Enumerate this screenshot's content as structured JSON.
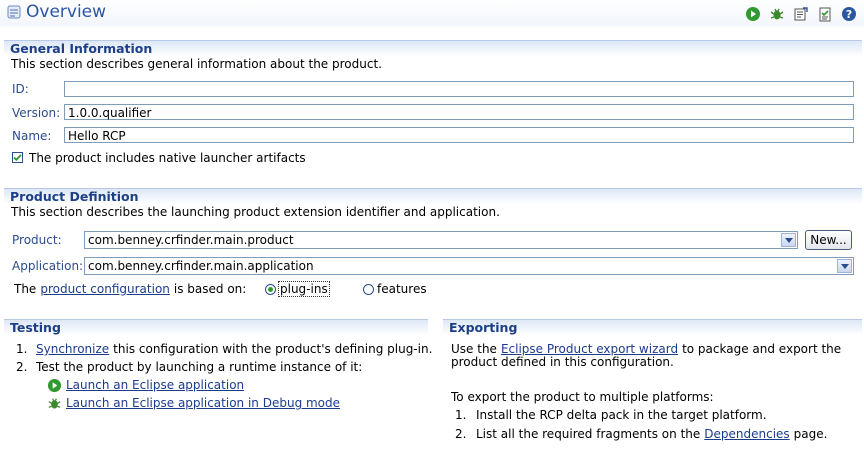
{
  "header": {
    "title": "Overview"
  },
  "toolbar": {
    "icons": [
      "run-icon",
      "debug-icon",
      "export-icon",
      "sync-icon",
      "help-icon"
    ]
  },
  "general": {
    "heading": "General Information",
    "description": "This section describes general information about the product.",
    "id_label": "ID:",
    "id_value": "",
    "version_label": "Version:",
    "version_value": "1.0.0.qualifier",
    "name_label": "Name:",
    "name_value": "Hello RCP",
    "native_launcher_label": "The product includes native launcher artifacts",
    "native_launcher_checked": true
  },
  "definition": {
    "heading": "Product Definition",
    "description": "This section describes the launching product extension identifier and application.",
    "product_label": "Product:",
    "product_value": "com.benney.crfinder.main.product",
    "new_button": "New...",
    "application_label": "Application:",
    "application_value": "com.benney.crfinder.main.application",
    "config_prefix": "The",
    "config_link": "product configuration",
    "config_suffix": "is based on:",
    "option_plugins": "plug-ins",
    "option_features": "features",
    "selected_option": "plug-ins"
  },
  "testing": {
    "heading": "Testing",
    "step1_num": "1.",
    "step1_link": "Synchronize",
    "step1_text": "this configuration with the product's defining plug-in.",
    "step2_num": "2.",
    "step2_text": "Test the product by launching a runtime instance of it:",
    "launch_link": "Launch an Eclipse application",
    "debug_link": "Launch an Eclipse application in Debug mode"
  },
  "exporting": {
    "heading": "Exporting",
    "line1_prefix": "Use the",
    "line1_link": "Eclipse Product export wizard",
    "line1_suffix": "to package and export the",
    "line2": "product defined in this configuration.",
    "multi_intro": "To export the product to multiple platforms:",
    "step1_num": "1.",
    "step1_text": "Install the RCP delta pack in the target platform.",
    "step2_num": "2.",
    "step2_prefix": "List all the required fragments on the",
    "step2_link": "Dependencies",
    "step2_suffix": "page."
  },
  "colors": {
    "title": "#2a57a2",
    "section_heading": "#1c3f87",
    "link": "#1d3b8d",
    "label": "#2b4c8f"
  }
}
